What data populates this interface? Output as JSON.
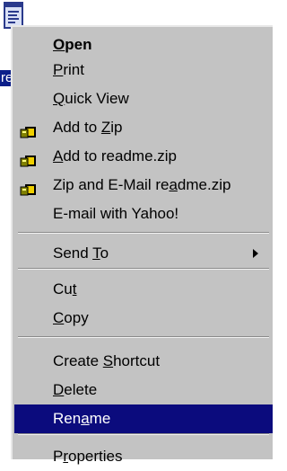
{
  "desktop": {
    "icon_name": "text-document-icon",
    "icon_label": "readme"
  },
  "menu": {
    "items": [
      {
        "label": "Open",
        "u": 0,
        "bold": true,
        "icon": null
      },
      {
        "label": "Print",
        "u": 0,
        "icon": null
      },
      {
        "label": "Quick View",
        "u": 0,
        "icon": null
      },
      {
        "label": "Add to Zip",
        "u": 7,
        "icon": "winzip-icon"
      },
      {
        "label": "Add to readme.zip",
        "u": 0,
        "icon": "winzip-icon"
      },
      {
        "label": "Zip and E-Mail readme.zip",
        "u": 17,
        "icon": "winzip-icon"
      },
      {
        "label": "E-mail with Yahoo!",
        "u": -1,
        "icon": null
      },
      {
        "label": "Send To",
        "u": 5,
        "submenu": true,
        "icon": null
      },
      {
        "label": "Cut",
        "u": 2,
        "icon": null
      },
      {
        "label": "Copy",
        "u": 0,
        "icon": null
      },
      {
        "label": "Create Shortcut",
        "u": 7,
        "icon": null
      },
      {
        "label": "Delete",
        "u": 0,
        "icon": null
      },
      {
        "label": "Rename",
        "u": 3,
        "selected": true,
        "icon": null
      },
      {
        "label": "Properties",
        "u": 1,
        "icon": null
      }
    ]
  },
  "colors": {
    "menu_bg": "#c3c3c3",
    "highlight": "#0b0b7d",
    "highlight_text": "#ffffff",
    "icon_label_bg": "#0b1f8a"
  }
}
